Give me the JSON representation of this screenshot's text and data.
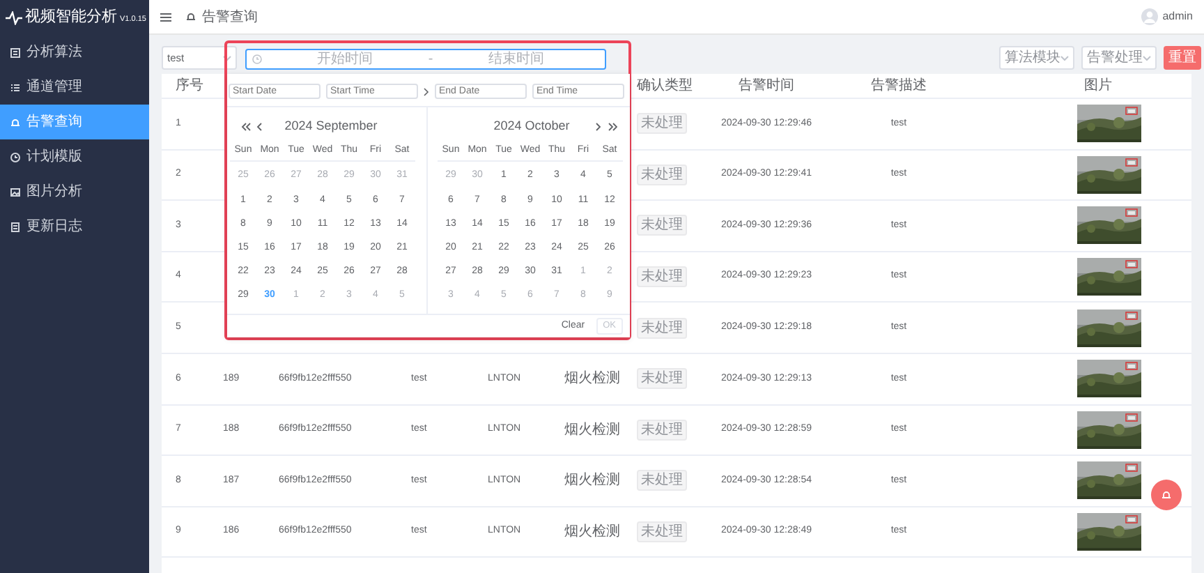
{
  "sidebar": {
    "title": "视频智能分析",
    "version": "V1.0.15",
    "items": [
      {
        "label": "分析算法",
        "selected": false
      },
      {
        "label": "通道管理",
        "selected": false
      },
      {
        "label": "告警查询",
        "selected": true
      },
      {
        "label": "计划模版",
        "selected": false
      },
      {
        "label": "图片分析",
        "selected": false
      },
      {
        "label": "更新日志",
        "selected": false
      }
    ]
  },
  "header": {
    "breadcrumb": "告警查询",
    "user": "admin"
  },
  "filters": {
    "device_select": "test",
    "range": {
      "start_placeholder": "开始时间",
      "separator": "-",
      "end_placeholder": "结束时间"
    },
    "algorithm_placeholder": "算法模块",
    "handling_placeholder": "告警处理",
    "reset": "重置"
  },
  "date_picker": {
    "start_date_placeholder": "Start Date",
    "start_time_placeholder": "Start Time",
    "end_date_placeholder": "End Date",
    "end_time_placeholder": "End Time",
    "clear": "Clear",
    "ok": "OK",
    "months": [
      {
        "title": "2024 September",
        "weekdays": [
          "Sun",
          "Mon",
          "Tue",
          "Wed",
          "Thu",
          "Fri",
          "Sat"
        ],
        "weeks": [
          [
            {
              "day": "25",
              "kind": "other"
            },
            {
              "day": "26",
              "kind": "other"
            },
            {
              "day": "27",
              "kind": "other"
            },
            {
              "day": "28",
              "kind": "other"
            },
            {
              "day": "29",
              "kind": "other"
            },
            {
              "day": "30",
              "kind": "other"
            },
            {
              "day": "31",
              "kind": "other"
            }
          ],
          [
            {
              "day": "1",
              "kind": "current"
            },
            {
              "day": "2",
              "kind": "current"
            },
            {
              "day": "3",
              "kind": "current"
            },
            {
              "day": "4",
              "kind": "current"
            },
            {
              "day": "5",
              "kind": "current"
            },
            {
              "day": "6",
              "kind": "current"
            },
            {
              "day": "7",
              "kind": "current"
            }
          ],
          [
            {
              "day": "8",
              "kind": "current"
            },
            {
              "day": "9",
              "kind": "current"
            },
            {
              "day": "10",
              "kind": "current"
            },
            {
              "day": "11",
              "kind": "current"
            },
            {
              "day": "12",
              "kind": "current"
            },
            {
              "day": "13",
              "kind": "current"
            },
            {
              "day": "14",
              "kind": "current"
            }
          ],
          [
            {
              "day": "15",
              "kind": "current"
            },
            {
              "day": "16",
              "kind": "current"
            },
            {
              "day": "17",
              "kind": "current"
            },
            {
              "day": "18",
              "kind": "current"
            },
            {
              "day": "19",
              "kind": "current"
            },
            {
              "day": "20",
              "kind": "current"
            },
            {
              "day": "21",
              "kind": "current"
            }
          ],
          [
            {
              "day": "22",
              "kind": "current"
            },
            {
              "day": "23",
              "kind": "current"
            },
            {
              "day": "24",
              "kind": "current"
            },
            {
              "day": "25",
              "kind": "current"
            },
            {
              "day": "26",
              "kind": "current"
            },
            {
              "day": "27",
              "kind": "current"
            },
            {
              "day": "28",
              "kind": "current"
            }
          ],
          [
            {
              "day": "29",
              "kind": "current"
            },
            {
              "day": "30",
              "kind": "today"
            },
            {
              "day": "1",
              "kind": "other"
            },
            {
              "day": "2",
              "kind": "other"
            },
            {
              "day": "3",
              "kind": "other"
            },
            {
              "day": "4",
              "kind": "other"
            },
            {
              "day": "5",
              "kind": "other"
            }
          ]
        ]
      },
      {
        "title": "2024 October",
        "weekdays": [
          "Sun",
          "Mon",
          "Tue",
          "Wed",
          "Thu",
          "Fri",
          "Sat"
        ],
        "weeks": [
          [
            {
              "day": "29",
              "kind": "other"
            },
            {
              "day": "30",
              "kind": "other"
            },
            {
              "day": "1",
              "kind": "current"
            },
            {
              "day": "2",
              "kind": "current"
            },
            {
              "day": "3",
              "kind": "current"
            },
            {
              "day": "4",
              "kind": "current"
            },
            {
              "day": "5",
              "kind": "current"
            }
          ],
          [
            {
              "day": "6",
              "kind": "current"
            },
            {
              "day": "7",
              "kind": "current"
            },
            {
              "day": "8",
              "kind": "current"
            },
            {
              "day": "9",
              "kind": "current"
            },
            {
              "day": "10",
              "kind": "current"
            },
            {
              "day": "11",
              "kind": "current"
            },
            {
              "day": "12",
              "kind": "current"
            }
          ],
          [
            {
              "day": "13",
              "kind": "current"
            },
            {
              "day": "14",
              "kind": "current"
            },
            {
              "day": "15",
              "kind": "current"
            },
            {
              "day": "16",
              "kind": "current"
            },
            {
              "day": "17",
              "kind": "current"
            },
            {
              "day": "18",
              "kind": "current"
            },
            {
              "day": "19",
              "kind": "current"
            }
          ],
          [
            {
              "day": "20",
              "kind": "current"
            },
            {
              "day": "21",
              "kind": "current"
            },
            {
              "day": "22",
              "kind": "current"
            },
            {
              "day": "23",
              "kind": "current"
            },
            {
              "day": "24",
              "kind": "current"
            },
            {
              "day": "25",
              "kind": "current"
            },
            {
              "day": "26",
              "kind": "current"
            }
          ],
          [
            {
              "day": "27",
              "kind": "current"
            },
            {
              "day": "28",
              "kind": "current"
            },
            {
              "day": "29",
              "kind": "current"
            },
            {
              "day": "30",
              "kind": "current"
            },
            {
              "day": "31",
              "kind": "current"
            },
            {
              "day": "1",
              "kind": "other"
            },
            {
              "day": "2",
              "kind": "other"
            }
          ],
          [
            {
              "day": "3",
              "kind": "other"
            },
            {
              "day": "4",
              "kind": "other"
            },
            {
              "day": "5",
              "kind": "other"
            },
            {
              "day": "6",
              "kind": "other"
            },
            {
              "day": "7",
              "kind": "other"
            },
            {
              "day": "8",
              "kind": "other"
            },
            {
              "day": "9",
              "kind": "other"
            }
          ]
        ]
      }
    ]
  },
  "table": {
    "columns": [
      "序号",
      "确认类型",
      "告警时间",
      "告警描述",
      "图片"
    ],
    "rows": [
      {
        "index": "1",
        "status": "未处理",
        "time": "2024-09-30 12:29:46",
        "description": "test"
      },
      {
        "index": "2",
        "status": "未处理",
        "time": "2024-09-30 12:29:41",
        "description": "test"
      },
      {
        "index": "3",
        "status": "未处理",
        "time": "2024-09-30 12:29:36",
        "description": "test"
      },
      {
        "index": "4",
        "status": "未处理",
        "time": "2024-09-30 12:29:23",
        "description": "test"
      },
      {
        "index": "5",
        "status": "未处理",
        "time": "2024-09-30 12:29:18",
        "description": "test"
      },
      {
        "index": "6",
        "id": "189",
        "hash": "66f9fb12e2fff550",
        "user": "test",
        "device": "LNTON",
        "type": "烟火检测",
        "status": "未处理",
        "time": "2024-09-30 12:29:13",
        "description": "test"
      },
      {
        "index": "7",
        "id": "188",
        "hash": "66f9fb12e2fff550",
        "user": "test",
        "device": "LNTON",
        "type": "烟火检测",
        "status": "未处理",
        "time": "2024-09-30 12:28:59",
        "description": "test"
      },
      {
        "index": "8",
        "id": "187",
        "hash": "66f9fb12e2fff550",
        "user": "test",
        "device": "LNTON",
        "type": "烟火检测",
        "status": "未处理",
        "time": "2024-09-30 12:28:54",
        "description": "test"
      },
      {
        "index": "9",
        "id": "186",
        "hash": "66f9fb12e2fff550",
        "user": "test",
        "device": "LNTON",
        "type": "烟火检测",
        "status": "未处理",
        "time": "2024-09-30 12:28:49",
        "description": "test"
      }
    ]
  }
}
